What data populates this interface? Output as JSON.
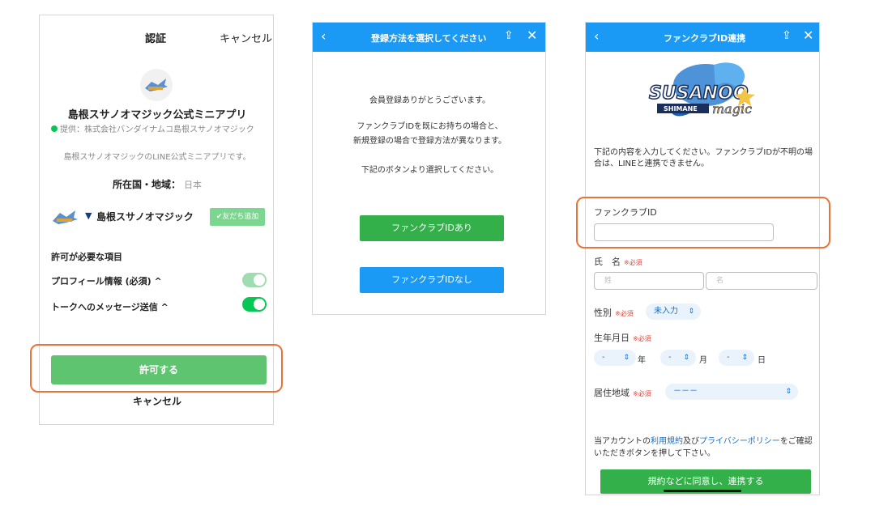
{
  "accent": {
    "line_green": "#06C755",
    "blue": "#1A9AF5",
    "highlight": "#E8743B"
  },
  "panel1": {
    "header_title": "認証",
    "header_cancel": "キャンセル",
    "logo_icon": "susanoo-magic-logo",
    "app_name": "島根スサノオマジック公式ミニアプリ",
    "provider": "提供：株式会社バンダイナムコ島根スサノオマジック",
    "description": "島根スサノオマジックのLINE公式ミニアプリです。",
    "region_label": "所在国・地域：",
    "region_value": "日本",
    "account_shield_icon": "shield-icon",
    "account_name": "島根スサノオマジック",
    "add_friend": "✔友だち追加",
    "permissions_title": "許可が必要な項目",
    "perm_profile": "プロフィール情報 (必須) ^",
    "perm_message": "トークへのメッセージ送信 ^",
    "allow_button": "許可する",
    "cancel_link": "キャンセル"
  },
  "panel2": {
    "back_icon": "‹",
    "title": "登録方法を選択してください",
    "share_icon": "⇪",
    "close_icon": "✕",
    "msg1": "会員登録ありがとうございます。",
    "msg2_line1": "ファンクラブIDを既にお持ちの場合と、",
    "msg2_line2": "新規登録の場合で登録方法が異なります。",
    "msg3": "下記のボタンより選択してください。",
    "btn_with_id": "ファンクラブIDあり",
    "btn_without_id": "ファンクラブIDなし"
  },
  "panel3": {
    "back_icon": "‹",
    "title": "ファンクラブID連携",
    "share_icon": "⇪",
    "close_icon": "✕",
    "logo_text_1": "SUSANOO",
    "logo_text_2": "SHIMANE",
    "logo_text_3": "magic",
    "intro": "下記の内容を入力してください。ファンクラブIDが不明の場合は、LINEと連携できません。",
    "fanclub_id_label": "ファンクラブID",
    "name_label": "氏　名",
    "required": "※必須",
    "surname_placeholder": "姓",
    "given_placeholder": "名",
    "gender_label": "性別",
    "gender_value": "未入力",
    "birth_label": "生年月日",
    "dash": "-",
    "year": "年",
    "month": "月",
    "day": "日",
    "residence_label": "居住地域",
    "residence_value": "－－－",
    "terms_prefix": "当アカウントの",
    "terms_link": "利用規約",
    "terms_and": "及び",
    "privacy_link": "プライバシーポリシー",
    "terms_suffix": "をご確認いただきボタンを押して下さい。",
    "submit": "規約などに同意し、連携する"
  }
}
